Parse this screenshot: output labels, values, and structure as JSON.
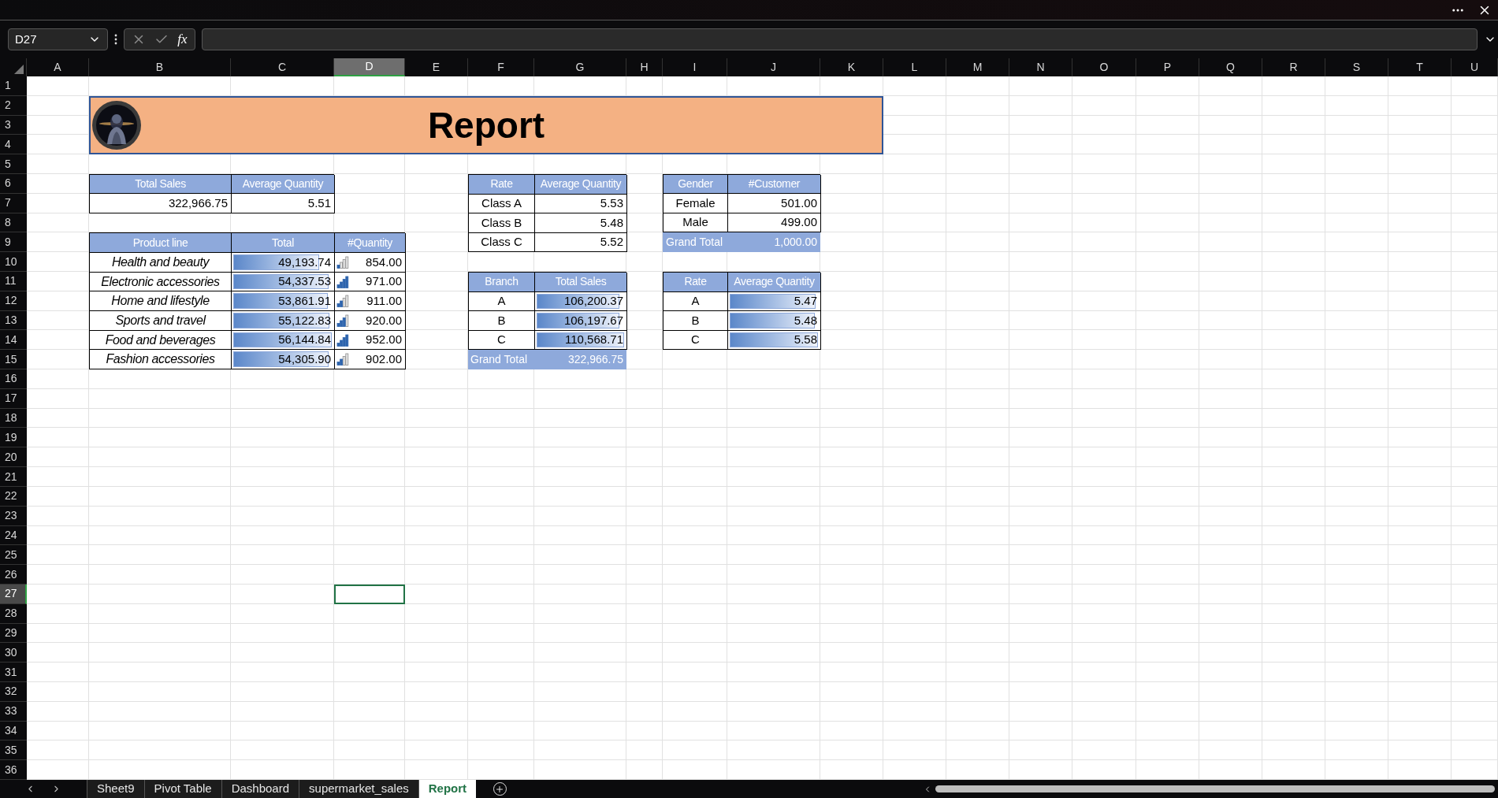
{
  "formula_bar": {
    "name_box": "D27",
    "function_label": "fx"
  },
  "columns": [
    {
      "label": "A",
      "selected": false
    },
    {
      "label": "B",
      "selected": false
    },
    {
      "label": "C",
      "selected": false
    },
    {
      "label": "D",
      "selected": true
    },
    {
      "label": "E",
      "selected": false
    },
    {
      "label": "F",
      "selected": false
    },
    {
      "label": "G",
      "selected": false
    },
    {
      "label": "H",
      "selected": false
    },
    {
      "label": "I",
      "selected": false
    },
    {
      "label": "J",
      "selected": false
    },
    {
      "label": "K",
      "selected": false
    },
    {
      "label": "L",
      "selected": false
    },
    {
      "label": "M",
      "selected": false
    },
    {
      "label": "N",
      "selected": false
    },
    {
      "label": "O",
      "selected": false
    },
    {
      "label": "P",
      "selected": false
    },
    {
      "label": "Q",
      "selected": false
    },
    {
      "label": "R",
      "selected": false
    },
    {
      "label": "S",
      "selected": false
    },
    {
      "label": "T",
      "selected": false
    },
    {
      "label": "U",
      "selected": false
    }
  ],
  "rows": [
    {
      "label": "1",
      "selected": false
    },
    {
      "label": "2",
      "selected": false
    },
    {
      "label": "3",
      "selected": false
    },
    {
      "label": "4",
      "selected": false
    },
    {
      "label": "5",
      "selected": false
    },
    {
      "label": "6",
      "selected": false
    },
    {
      "label": "7",
      "selected": false
    },
    {
      "label": "8",
      "selected": false
    },
    {
      "label": "9",
      "selected": false
    },
    {
      "label": "10",
      "selected": false
    },
    {
      "label": "11",
      "selected": false
    },
    {
      "label": "12",
      "selected": false
    },
    {
      "label": "13",
      "selected": false
    },
    {
      "label": "14",
      "selected": false
    },
    {
      "label": "15",
      "selected": false
    },
    {
      "label": "16",
      "selected": false
    },
    {
      "label": "17",
      "selected": false
    },
    {
      "label": "18",
      "selected": false
    },
    {
      "label": "19",
      "selected": false
    },
    {
      "label": "20",
      "selected": false
    },
    {
      "label": "21",
      "selected": false
    },
    {
      "label": "22",
      "selected": false
    },
    {
      "label": "23",
      "selected": false
    },
    {
      "label": "24",
      "selected": false
    },
    {
      "label": "25",
      "selected": false
    },
    {
      "label": "26",
      "selected": false
    },
    {
      "label": "27",
      "selected": true
    },
    {
      "label": "28",
      "selected": false
    },
    {
      "label": "29",
      "selected": false
    },
    {
      "label": "30",
      "selected": false
    },
    {
      "label": "31",
      "selected": false
    },
    {
      "label": "32",
      "selected": false
    },
    {
      "label": "33",
      "selected": false
    },
    {
      "label": "34",
      "selected": false
    },
    {
      "label": "35",
      "selected": false
    },
    {
      "label": "36",
      "selected": false
    }
  ],
  "report_banner": {
    "title": "Report"
  },
  "summary": {
    "headers": [
      "Total Sales",
      "Average Quantity"
    ],
    "values": [
      "322,966.75",
      "5.51"
    ]
  },
  "product_lines": {
    "headers": [
      "Product line",
      "Total",
      "#Quantity"
    ],
    "rows": [
      {
        "name": "Health and beauty",
        "total": {
          "value": "49,193.74",
          "level": 0.87
        },
        "quantity": {
          "value": "854.00",
          "level": 0.25
        }
      },
      {
        "name": "Electronic accessories",
        "total": {
          "value": "54,337.53",
          "level": 0.96
        },
        "quantity": {
          "value": "971.00",
          "level": 1
        }
      },
      {
        "name": "Home and lifestyle",
        "total": {
          "value": "53,861.91",
          "level": 0.95
        },
        "quantity": {
          "value": "911.00",
          "level": 0.5
        }
      },
      {
        "name": "Sports and travel",
        "total": {
          "value": "55,122.83",
          "level": 0.97
        },
        "quantity": {
          "value": "920.00",
          "level": 0.75
        }
      },
      {
        "name": "Food and beverages",
        "total": {
          "value": "56,144.84",
          "level": 0.99
        },
        "quantity": {
          "value": "952.00",
          "level": 1
        }
      },
      {
        "name": "Fashion accessories",
        "total": {
          "value": "54,305.90",
          "level": 0.96
        },
        "quantity": {
          "value": "902.00",
          "level": 0.5
        }
      }
    ]
  },
  "rate_quantity": {
    "headers": [
      "Rate",
      "Average Quantity"
    ],
    "rows": [
      {
        "label": "Class A",
        "value": "5.53"
      },
      {
        "label": "Class B",
        "value": "5.48"
      },
      {
        "label": "Class C",
        "value": "5.52"
      }
    ]
  },
  "gender_customers": {
    "headers": [
      "Gender",
      "#Customer"
    ],
    "rows": [
      {
        "label": "Female",
        "value": "501.00"
      },
      {
        "label": "Male",
        "value": "499.00"
      }
    ],
    "grand_total": {
      "label": "Grand Total",
      "value": "1,000.00"
    }
  },
  "branch_sales": {
    "headers": [
      "Branch",
      "Total Sales"
    ],
    "rows": [
      {
        "label": "A",
        "value": "106,200.37",
        "level": 0.94
      },
      {
        "label": "B",
        "value": "106,197.67",
        "level": 0.94
      },
      {
        "label": "C",
        "value": "110,568.71",
        "level": 0.99
      }
    ],
    "grand_total": {
      "label": "Grand Total",
      "value": "322,966.75"
    }
  },
  "rate_average": {
    "headers": [
      "Rate",
      "Average Quantity"
    ],
    "rows": [
      {
        "label": "A",
        "value": "5.47",
        "level": 0.97
      },
      {
        "label": "B",
        "value": "5.48",
        "level": 0.96
      },
      {
        "label": "C",
        "value": "5.58",
        "level": 0.99
      }
    ]
  },
  "sheet_tabs": [
    {
      "label": "Sheet9",
      "selected": false
    },
    {
      "label": "Pivot Table",
      "selected": false
    },
    {
      "label": "Dashboard",
      "selected": false
    },
    {
      "label": "supermarket_sales",
      "selected": false
    },
    {
      "label": "Report",
      "selected": true
    }
  ]
}
